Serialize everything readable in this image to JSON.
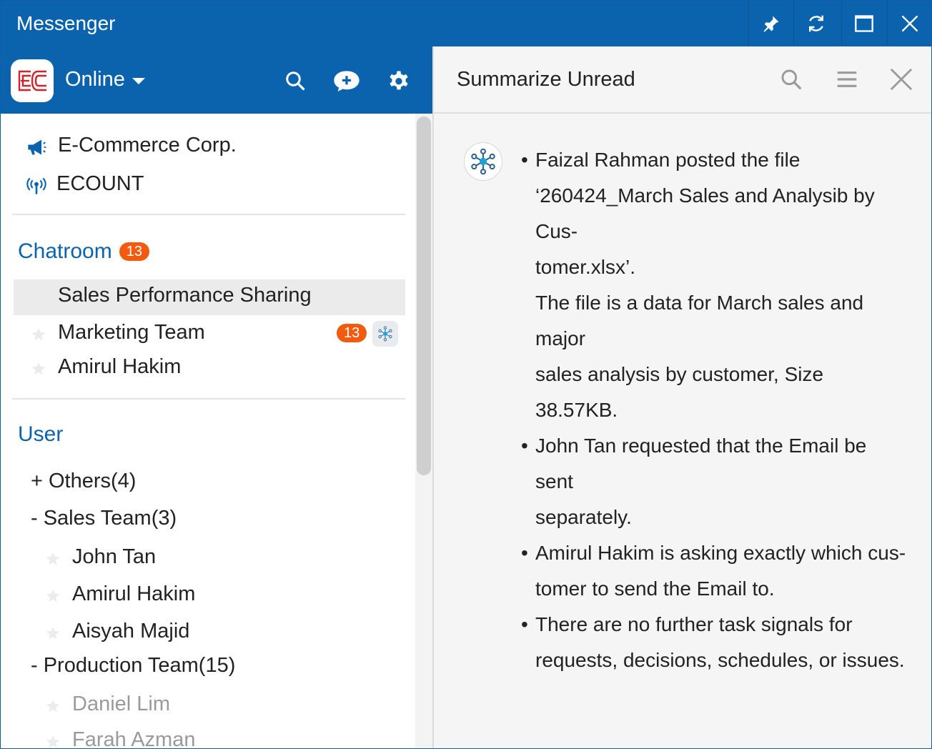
{
  "window": {
    "title": "Messenger",
    "buttons": [
      "pin-icon",
      "refresh-icon",
      "maximize-icon",
      "close-icon"
    ]
  },
  "sidebar": {
    "status": "Online",
    "header_icons": [
      "search-icon",
      "new-chat-icon",
      "gear-icon"
    ],
    "channels": [
      {
        "label": "E-Commerce Corp.",
        "icon": "megaphone-icon"
      },
      {
        "label": "ECOUNT",
        "icon": "broadcast-icon"
      }
    ],
    "chatroom": {
      "title": "Chatroom",
      "badge": "13",
      "items": [
        {
          "label": "Sales Performance Sharing"
        },
        {
          "label": "Marketing Team",
          "badge": "13"
        },
        {
          "label": "Amirul Hakim"
        }
      ]
    },
    "user": {
      "title": "User",
      "groups": [
        {
          "label": "+ Others(4)"
        },
        {
          "label": "- Sales Team(3)"
        },
        {
          "label": "- Production Team(15)"
        }
      ],
      "sales_members": [
        "John Tan",
        "Amirul Hakim",
        "Aisyah Majid"
      ],
      "production_members": [
        "Daniel Lim",
        "Farah Azman"
      ]
    }
  },
  "panel": {
    "title": "Summarize Unread",
    "bullets": [
      "•",
      "•",
      "•",
      "•"
    ],
    "lines": [
      "Faizal Rahman posted the file",
      "‘260424_March Sales and Analysib by Cus-",
      "tomer.xlsx’.",
      "The file is a data for March sales and major",
      "sales analysis by customer, Size 38.57KB.",
      "John Tan requested that the Email be sent",
      "separately.",
      "Amirul Hakim is asking exactly which cus-",
      "tomer to send the Email to.",
      "There are no further task signals for",
      "requests, decisions, schedules, or issues."
    ]
  },
  "colors": {
    "brand": "#0b63ad",
    "badge": "#f15a0f",
    "selected_row": "#ebebeb"
  }
}
